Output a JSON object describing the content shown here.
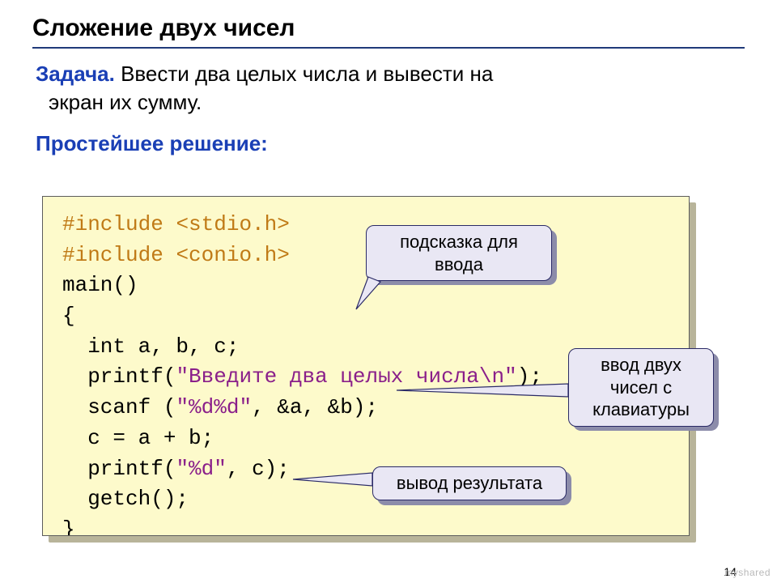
{
  "title": "Сложение двух чисел",
  "task": {
    "lead": "Задача.",
    "line1": " Ввести два целых числа и вывести на",
    "line2": "экран их сумму."
  },
  "subhead": "Простейшее решение:",
  "code": {
    "l1a": "#include ",
    "l1b": "<stdio.h>",
    "l2a": "#include ",
    "l2b": "<conio.h>",
    "l3": "main()",
    "l4": "{",
    "l5": "  int a, b, c;",
    "l6a": "  printf(",
    "l6b": "\"Введите два целых числа\\n\"",
    "l6c": ");",
    "l7a": "  scanf (",
    "l7b": "\"%d%d\"",
    "l7c": ", &a, &b);",
    "l8": "  c = a + b;",
    "l9a": "  printf(",
    "l9b": "\"%d\"",
    "l9c": ", c);",
    "l10": "  getch();",
    "l11": "}"
  },
  "callouts": {
    "hint": "подсказка для\nввода",
    "input": "ввод двух\nчисел с\nклавиатуры",
    "output": "вывод результата"
  },
  "page_number": "14",
  "watermark": "myshared"
}
